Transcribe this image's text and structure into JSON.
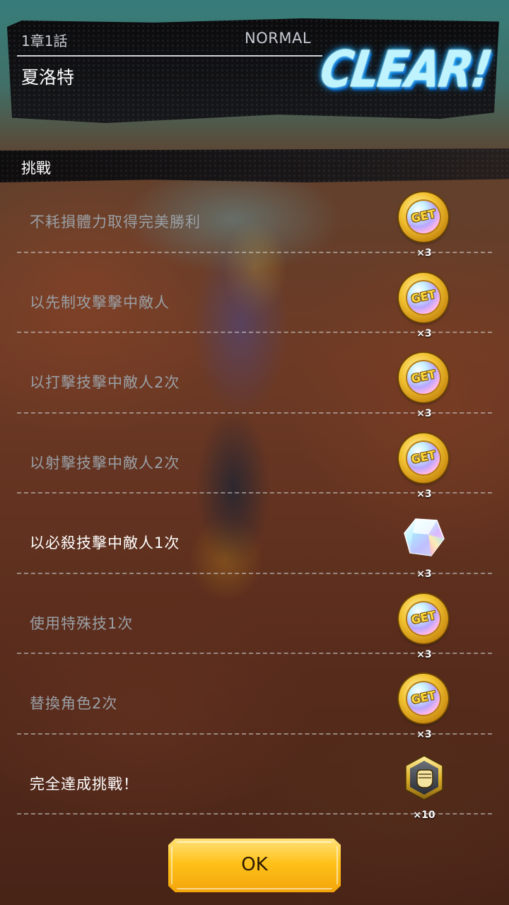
{
  "header": {
    "chapter": "1章1話",
    "difficulty": "NORMAL",
    "stage_name": "夏洛特",
    "result": "CLEAR!"
  },
  "section": {
    "title": "挑戰"
  },
  "challenges": [
    {
      "text": "不耗損體力取得完美勝利",
      "completed": false,
      "reward_icon": "get-medal-icon",
      "reward_qty": "×3"
    },
    {
      "text": "以先制攻擊擊中敵人",
      "completed": false,
      "reward_icon": "get-medal-icon",
      "reward_qty": "×3"
    },
    {
      "text": "以打擊技擊中敵人2次",
      "completed": false,
      "reward_icon": "get-medal-icon",
      "reward_qty": "×3"
    },
    {
      "text": "以射擊技擊中敵人2次",
      "completed": false,
      "reward_icon": "get-medal-icon",
      "reward_qty": "×3"
    },
    {
      "text": "以必殺技擊中敵人1次",
      "completed": true,
      "reward_icon": "chrono-crystal-icon",
      "reward_qty": "×3"
    },
    {
      "text": "使用特殊技1次",
      "completed": false,
      "reward_icon": "get-medal-icon",
      "reward_qty": "×3"
    },
    {
      "text": "替換角色2次",
      "completed": false,
      "reward_icon": "get-medal-icon",
      "reward_qty": "×3"
    },
    {
      "text": "完全達成挑戰！",
      "completed": true,
      "reward_icon": "fist-badge-icon",
      "reward_qty": "×10"
    }
  ],
  "get_medal_label": "GET",
  "ok_button": {
    "label": "OK"
  },
  "colors": {
    "completed_text": "#ffffff",
    "incomplete_text": "#9aa0a6",
    "ok_button": "#ffc21a",
    "clear_glow": "#3ad0ff"
  }
}
